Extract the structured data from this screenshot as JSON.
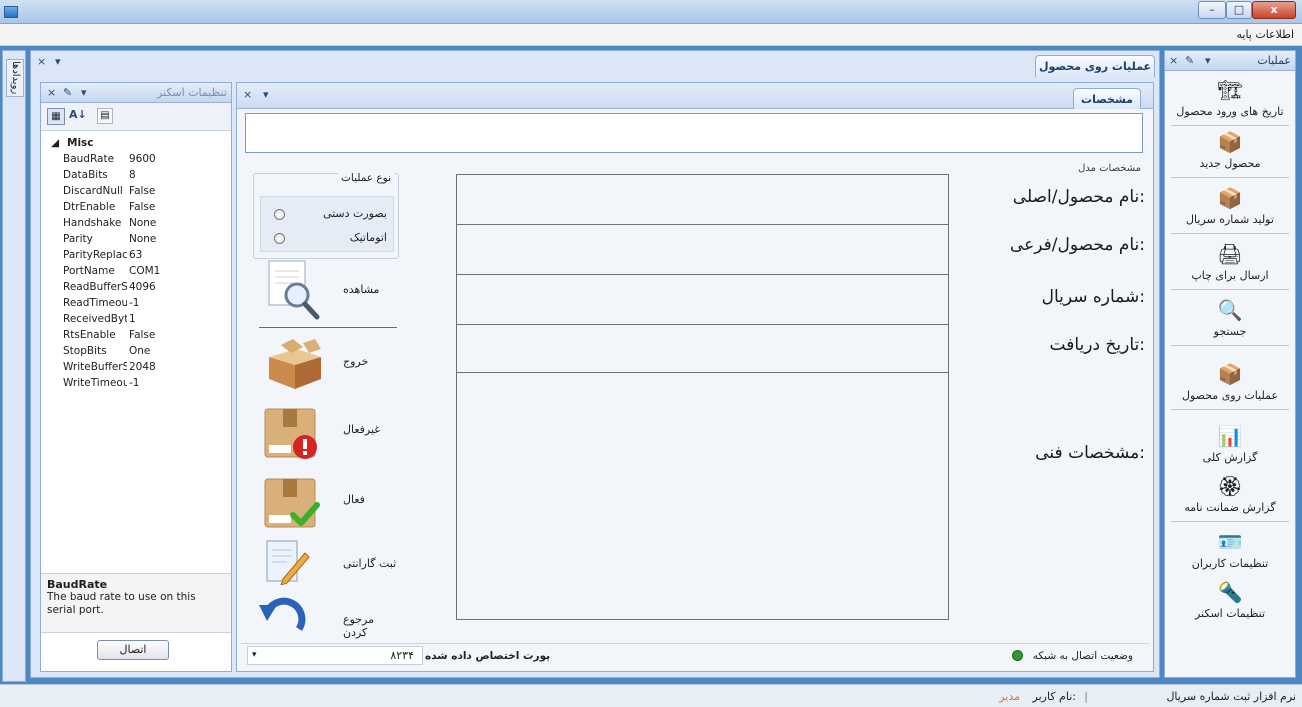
{
  "window": {
    "minimize": "–",
    "maximize": "□",
    "close": "x"
  },
  "menubar": {
    "item": "اطلاعات پایه"
  },
  "left_strip": {
    "label": "رویدادها"
  },
  "nav": {
    "title": "عملیات",
    "items": [
      {
        "label": "تاریخ های ورود محصول",
        "icon": "forklift-boxes-icon"
      },
      {
        "label": "محصول جدید",
        "icon": "box-add-icon"
      },
      {
        "label": "تولید شماره سریال",
        "icon": "box-plus-icon"
      },
      {
        "label": "ارسال برای چاپ",
        "icon": "printer-icon"
      },
      {
        "label": "جستجو",
        "icon": "magnifier-icon"
      },
      {
        "label": "عملیات روی محصول",
        "icon": "open-box-icon"
      },
      {
        "label": "گزارش کلی",
        "icon": "report-chart-icon"
      },
      {
        "label": "گزارش ضمانت نامه",
        "icon": "warranty-seal-icon"
      },
      {
        "label": "تنظیمات کاربران",
        "icon": "user-card-icon"
      },
      {
        "label": "تنظیمات اسکنر",
        "icon": "scanner-icon"
      }
    ]
  },
  "doc_tab": {
    "label": "عملیات روی محصول"
  },
  "inner_tab": {
    "label": "مشخصات"
  },
  "model_section": {
    "title": "مشخصات مدل"
  },
  "fields": [
    {
      "label": "نام محصول/اصلی:"
    },
    {
      "label": "نام محصول/فرعی:"
    },
    {
      "label": "شماره سریال:"
    },
    {
      "label": "تاریخ دریافت:"
    },
    {
      "label": "مشخصات فنی:"
    }
  ],
  "operation_type": {
    "title": "نوع عملیات",
    "options": [
      {
        "label": "بصورت دستی"
      },
      {
        "label": "اتوماتیک"
      }
    ],
    "view_label": "مشاهده"
  },
  "actions": [
    {
      "label": "خروج",
      "icon": "open-box-exit-icon"
    },
    {
      "label": "غیرفعال",
      "icon": "box-error-icon"
    },
    {
      "label": "فعال",
      "icon": "box-check-icon"
    },
    {
      "label": "ثبت گارانتی",
      "icon": "document-pen-icon"
    },
    {
      "label": "مرجوع کردن",
      "icon": "undo-arrow-icon"
    }
  ],
  "status_strip": {
    "network_label": "وضعیت اتصال به شبکه",
    "network_color": "#2e9a2e",
    "port_label": "پورت اختصاص داده شده",
    "port_value": "۸۲۳۴"
  },
  "scanner_panel": {
    "title": "تنظیمات اسکنر",
    "category": "Misc",
    "properties": [
      {
        "name": "BaudRate",
        "value": "9600"
      },
      {
        "name": "DataBits",
        "value": "8"
      },
      {
        "name": "DiscardNull",
        "value": "False"
      },
      {
        "name": "DtrEnable",
        "value": "False"
      },
      {
        "name": "Handshake",
        "value": "None"
      },
      {
        "name": "Parity",
        "value": "None"
      },
      {
        "name": "ParityReplace",
        "value": "63"
      },
      {
        "name": "PortName",
        "value": "COM1"
      },
      {
        "name": "ReadBufferSize",
        "value": "4096"
      },
      {
        "name": "ReadTimeout",
        "value": "-1"
      },
      {
        "name": "ReceivedBytesThreshold",
        "value": "1"
      },
      {
        "name": "RtsEnable",
        "value": "False"
      },
      {
        "name": "StopBits",
        "value": "One"
      },
      {
        "name": "WriteBufferSize",
        "value": "2048"
      },
      {
        "name": "WriteTimeout",
        "value": "-1"
      }
    ],
    "description_title": "BaudRate",
    "description_text": "The baud rate to use on this serial port.",
    "connect_label": "اتصال"
  },
  "statusbar": {
    "app_name": "نرم افزار ثبت شماره سریال",
    "user_label": "نام کاربر:",
    "user_value": "مدیر"
  }
}
